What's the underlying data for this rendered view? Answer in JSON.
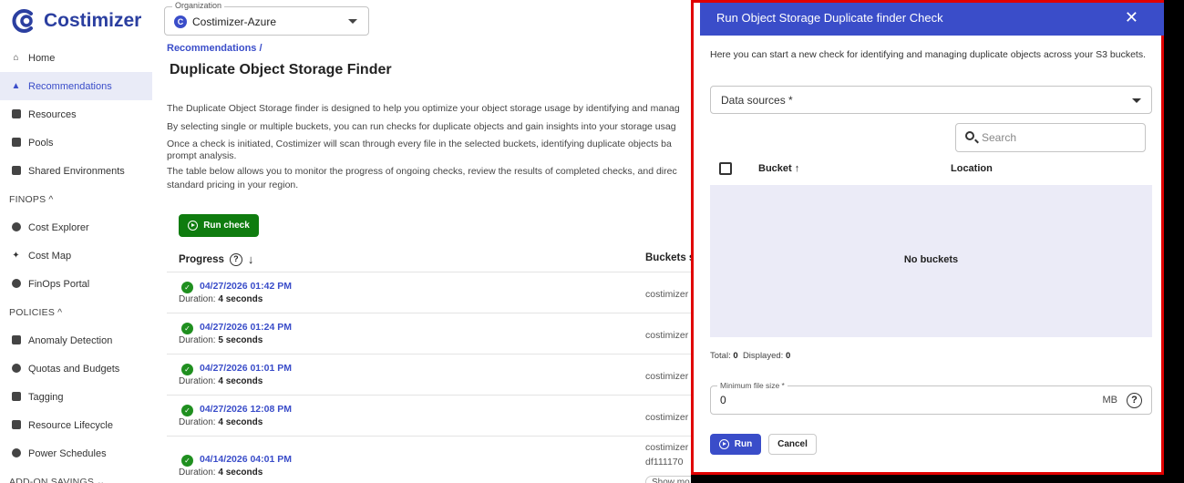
{
  "app": {
    "brand": "Costimizer",
    "brand_color": "#2b3fa0",
    "accent": "#3a4dc9"
  },
  "org": {
    "legend": "Organization",
    "avatar_letter": "C",
    "name": "Costimizer-Azure"
  },
  "sidebar": {
    "items": [
      {
        "label": "Home",
        "icon": "home-icon"
      },
      {
        "label": "Recommendations",
        "icon": "thumbs-up-icon",
        "active": true
      },
      {
        "label": "Resources",
        "icon": "bar-chart-icon"
      },
      {
        "label": "Pools",
        "icon": "pools-icon"
      },
      {
        "label": "Shared Environments",
        "icon": "shared-env-icon"
      }
    ],
    "sections": {
      "finops": {
        "label": "FINOPS ^",
        "items": [
          {
            "label": "Cost Explorer",
            "icon": "compass-icon"
          },
          {
            "label": "Cost Map",
            "icon": "map-icon"
          },
          {
            "label": "FinOps Portal",
            "icon": "dollar-icon"
          }
        ]
      },
      "policies": {
        "label": "POLICIES ^",
        "items": [
          {
            "label": "Anomaly Detection",
            "icon": "anomaly-icon"
          },
          {
            "label": "Quotas and Budgets",
            "icon": "quota-icon"
          },
          {
            "label": "Tagging",
            "icon": "tag-icon"
          },
          {
            "label": "Resource Lifecycle",
            "icon": "lifecycle-icon"
          },
          {
            "label": "Power Schedules",
            "icon": "clock-icon"
          }
        ]
      },
      "addon": {
        "label": "ADD-ON SAVINGS ⌄"
      }
    }
  },
  "main": {
    "breadcrumb": "Recommendations  /",
    "title": "Duplicate Object Storage Finder",
    "description": [
      "The Duplicate Object Storage finder is designed to help you optimize your object storage usage by identifying and manag",
      "By selecting single or multiple buckets, you can run checks for duplicate objects and gain insights into your storage usag",
      "Once a check is initiated, Costimizer will scan through every file in the selected buckets, identifying duplicate objects ba",
      "prompt analysis.",
      "The table below allows you to monitor the progress of ongoing checks, review the results of completed checks, and direc",
      "standard pricing in your region."
    ],
    "run_check_label": "Run check",
    "table": {
      "col_progress": "Progress",
      "col_buckets": "Buckets s",
      "duration_label": "Duration:",
      "rows": [
        {
          "datetime": "04/27/2026 01:42 PM",
          "duration": "4 seconds",
          "bucket": "costimizer"
        },
        {
          "datetime": "04/27/2026 01:24 PM",
          "duration": "5 seconds",
          "bucket": "costimizer"
        },
        {
          "datetime": "04/27/2026 01:01 PM",
          "duration": "4 seconds",
          "bucket": "costimizer"
        },
        {
          "datetime": "04/27/2026 12:08 PM",
          "duration": "4 seconds",
          "bucket": "costimizer"
        },
        {
          "datetime": "04/14/2026 04:01 PM",
          "duration": "4 seconds",
          "bucket": "costimizer",
          "bucket2": "df111170"
        }
      ],
      "show_more": "Show mo"
    }
  },
  "drawer": {
    "title": "Run Object Storage Duplicate finder Check",
    "intro": "Here you can start a new check for identifying and managing duplicate objects across your S3 buckets.",
    "data_sources_label": "Data sources *",
    "search_placeholder": "Search",
    "col_bucket": "Bucket ↑",
    "col_location": "Location",
    "empty_text": "No buckets",
    "totals": {
      "total_label": "Total:",
      "total": "0",
      "displayed_label": "Displayed:",
      "displayed": "0"
    },
    "min_size": {
      "legend": "Minimum file size *",
      "value": "0",
      "unit": "MB"
    },
    "run_label": "Run",
    "cancel_label": "Cancel",
    "highlight_color": "#e00000"
  }
}
